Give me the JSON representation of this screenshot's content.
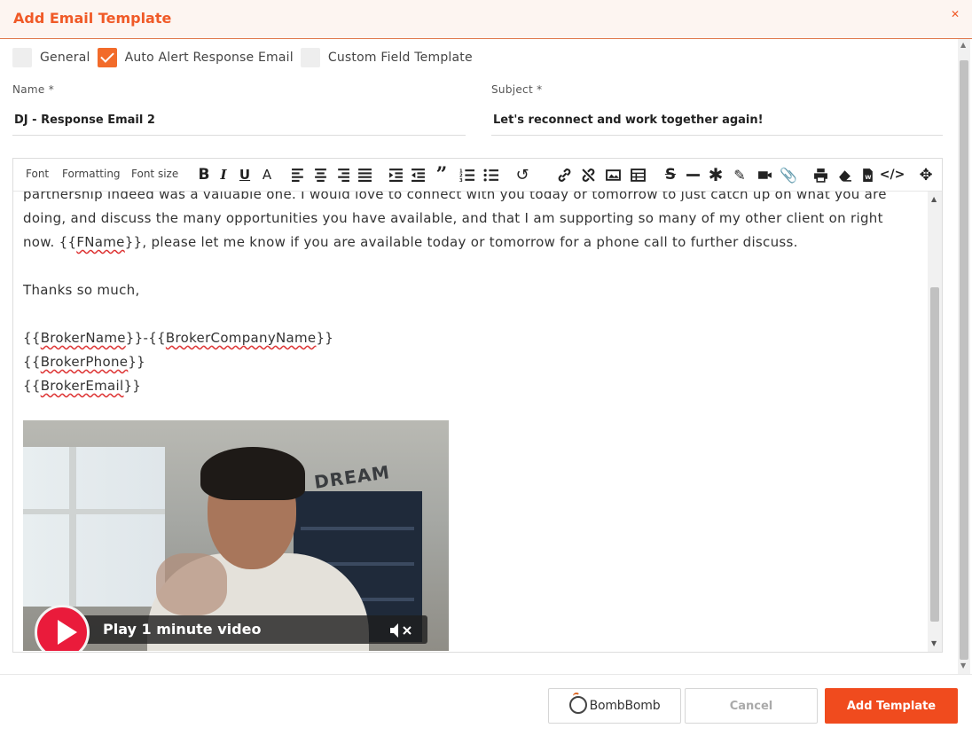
{
  "modal": {
    "title": "Add Email Template",
    "close_icon": "close-icon"
  },
  "template_types": [
    {
      "label": "General",
      "checked": false
    },
    {
      "label": "Auto Alert Response Email",
      "checked": true
    },
    {
      "label": "Custom Field Template",
      "checked": false
    }
  ],
  "fields": {
    "name_label": "Name *",
    "name_value": "DJ - Response Email 2",
    "subject_label": "Subject *",
    "subject_value": "Let's reconnect and work together again!"
  },
  "toolbar": {
    "font": "Font",
    "formatting": "Formatting",
    "font_size": "Font size",
    "icons": [
      "bold-icon",
      "italic-icon",
      "underline-icon",
      "font-color-icon",
      "align-left-icon",
      "align-center-icon",
      "align-right-icon",
      "align-justify-icon",
      "indent-icon",
      "outdent-icon",
      "quote-icon",
      "ordered-list-icon",
      "unordered-list-icon",
      "undo-icon",
      "link-icon",
      "unlink-icon",
      "image-icon",
      "table-icon",
      "strikethrough-icon",
      "horizontal-rule-icon",
      "special-char-icon",
      "pen-icon",
      "video-icon",
      "attachment-icon",
      "print-icon",
      "eraser-icon",
      "word-icon",
      "code-icon",
      "move-icon"
    ]
  },
  "editor": {
    "line1": "partnership indeed was a valuable one.   I would love to connect with you today or tomorrow to just catch up on what you are",
    "line2": "doing, and discuss the many opportunities you have available, and that I am supporting so many of my other client on right",
    "line3_pre": "now.  {{",
    "line3_tag": "FName",
    "line3_post": "}}, please let me know if you are available today or tomorrow for a phone call to further discuss.",
    "thanks": "Thanks so much,",
    "sig1_a_pre": "{{",
    "sig1_a_tag": "BrokerName",
    "sig1_mid": "}}-{{",
    "sig1_b_tag": "BrokerCompanyName",
    "sig1_post": "}}",
    "sig2_pre": "{{",
    "sig2_tag": "BrokerPhone",
    "sig2_post": "}}",
    "sig3_pre": "{{",
    "sig3_tag": "BrokerEmail",
    "sig3_post": "}}",
    "video_label": "Play 1 minute video",
    "video_wall_text": "DREAM"
  },
  "footer": {
    "bombbomb_label": "BombBomb",
    "cancel_label": "Cancel",
    "add_label": "Add Template"
  },
  "colors": {
    "accent": "#f05a28",
    "primary_button": "#f04b1e",
    "play_button": "#ea1b3b"
  }
}
